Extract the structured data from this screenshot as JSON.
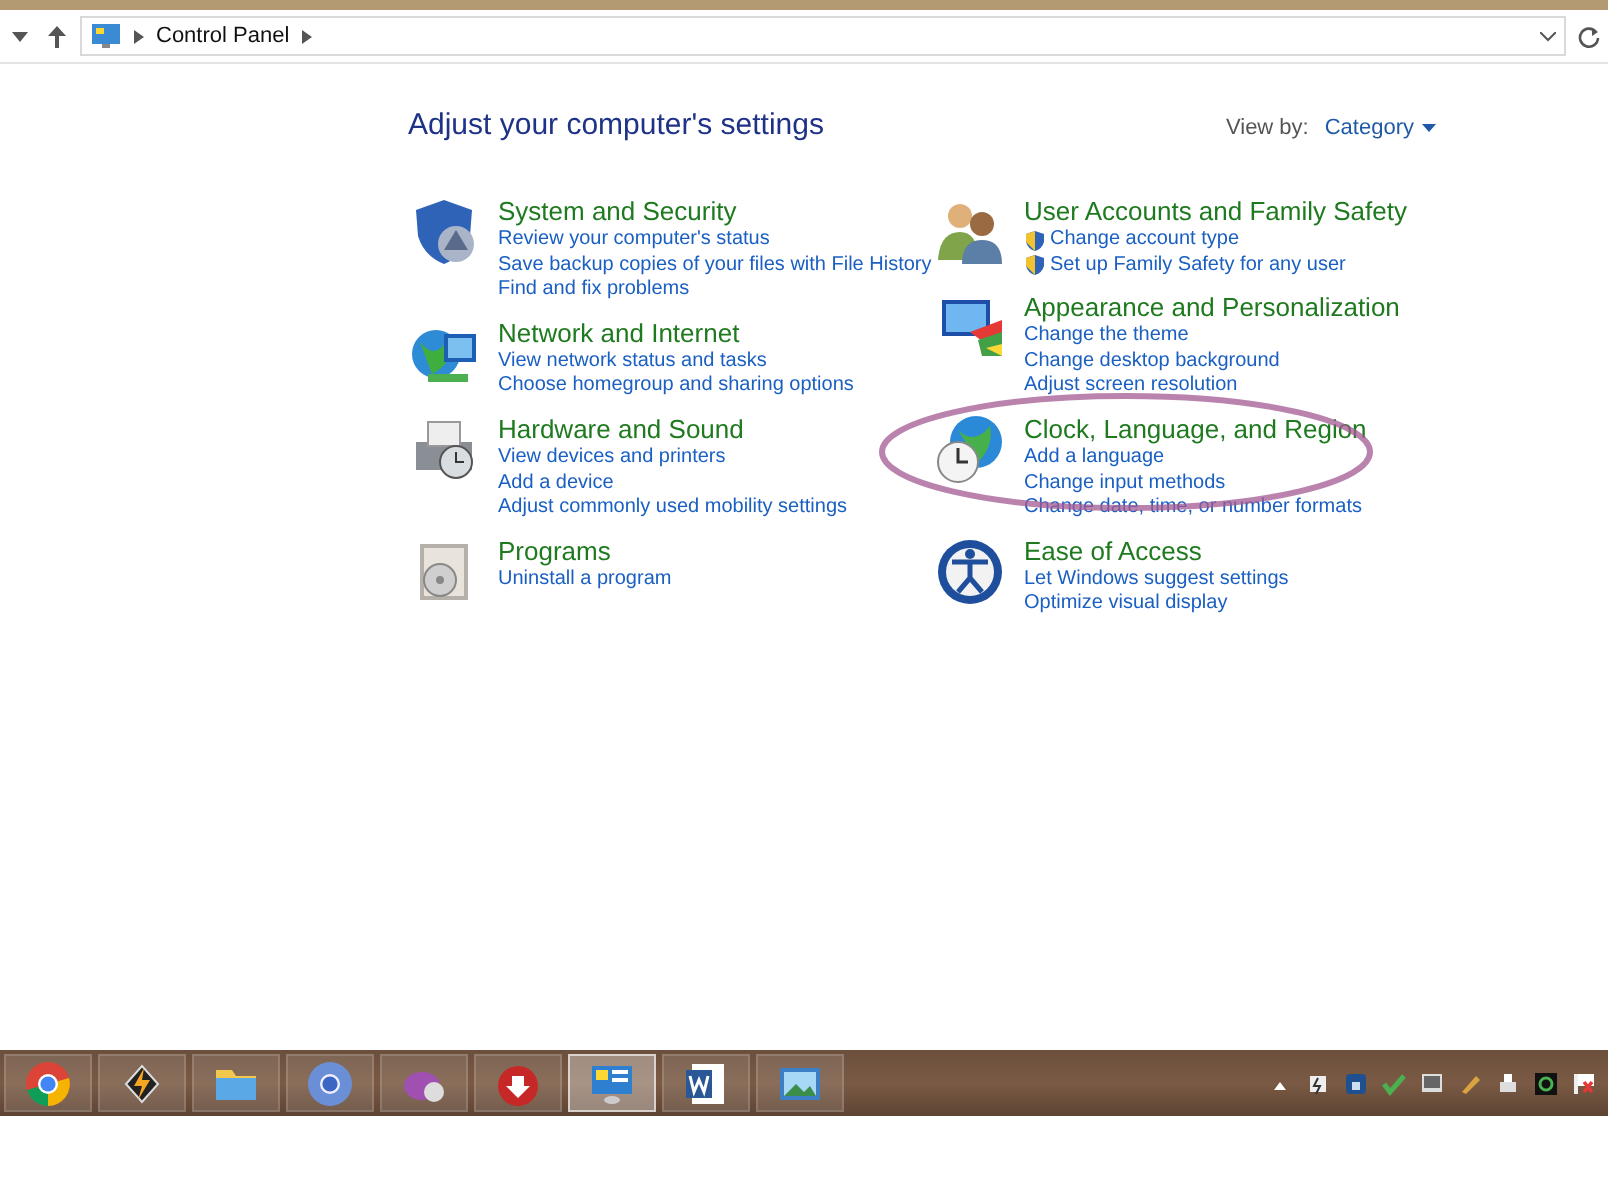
{
  "address_bar": {
    "path": [
      "Control Panel"
    ]
  },
  "heading": "Adjust your computer's settings",
  "view_by": {
    "label": "View by:",
    "value": "Category"
  },
  "columns": [
    [
      {
        "kind": "shield",
        "title": "System and Security",
        "links": [
          {
            "text": "Review your computer's status",
            "kind": "plain"
          },
          {
            "text": "Save backup copies of your files with File History",
            "kind": "plain"
          },
          {
            "text": "Find and fix problems",
            "kind": "plain"
          }
        ]
      },
      {
        "kind": "network",
        "title": "Network and Internet",
        "links": [
          {
            "text": "View network status and tasks",
            "kind": "plain"
          },
          {
            "text": "Choose homegroup and sharing options",
            "kind": "plain"
          }
        ]
      },
      {
        "kind": "printer",
        "title": "Hardware and Sound",
        "links": [
          {
            "text": "View devices and printers",
            "kind": "plain"
          },
          {
            "text": "Add a device",
            "kind": "plain"
          },
          {
            "text": "Adjust commonly used mobility settings",
            "kind": "plain"
          }
        ]
      },
      {
        "kind": "programs",
        "title": "Programs",
        "links": [
          {
            "text": "Uninstall a program",
            "kind": "plain"
          }
        ]
      }
    ],
    [
      {
        "kind": "users",
        "title": "User Accounts and Family Safety",
        "links": [
          {
            "text": "Change account type",
            "kind": "shield"
          },
          {
            "text": "Set up Family Safety for any user",
            "kind": "shield"
          }
        ]
      },
      {
        "kind": "appearance",
        "title": "Appearance and Personalization",
        "links": [
          {
            "text": "Change the theme",
            "kind": "plain"
          },
          {
            "text": "Change desktop background",
            "kind": "plain"
          },
          {
            "text": "Adjust screen resolution",
            "kind": "plain"
          }
        ]
      },
      {
        "kind": "clock",
        "title": "Clock, Language, and Region",
        "links": [
          {
            "text": "Add a language",
            "kind": "plain"
          },
          {
            "text": "Change input methods",
            "kind": "plain"
          },
          {
            "text": "Change date, time, or number formats",
            "kind": "plain"
          }
        ]
      },
      {
        "kind": "access",
        "title": "Ease of Access",
        "links": [
          {
            "text": "Let Windows suggest settings",
            "kind": "plain"
          },
          {
            "text": "Optimize visual display",
            "kind": "plain"
          }
        ]
      }
    ]
  ],
  "taskbar": [
    {
      "kind": "chrome",
      "selected": false
    },
    {
      "kind": "lightning",
      "selected": false
    },
    {
      "kind": "folder",
      "selected": false
    },
    {
      "kind": "chromium",
      "selected": false
    },
    {
      "kind": "purple",
      "selected": false
    },
    {
      "kind": "download",
      "selected": false
    },
    {
      "kind": "panel",
      "selected": true
    },
    {
      "kind": "word",
      "selected": false
    },
    {
      "kind": "picture",
      "selected": false
    }
  ],
  "tray": [
    {
      "kind": "caret"
    },
    {
      "kind": "bolt"
    },
    {
      "kind": "lock"
    },
    {
      "kind": "check"
    },
    {
      "kind": "monitor"
    },
    {
      "kind": "pencil"
    },
    {
      "kind": "printer"
    },
    {
      "kind": "refresh"
    },
    {
      "kind": "flag"
    }
  ]
}
